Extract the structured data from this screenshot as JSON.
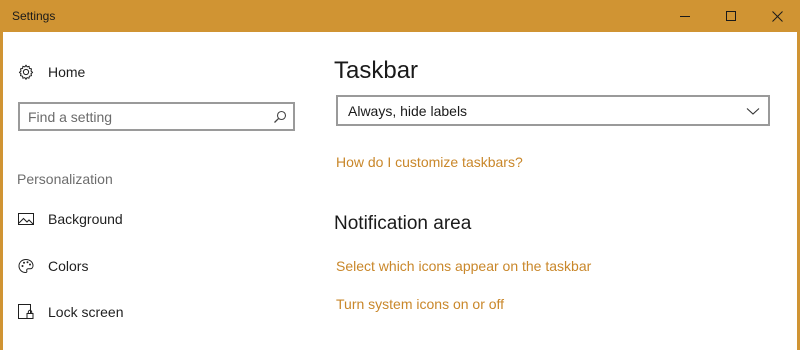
{
  "window": {
    "title": "Settings"
  },
  "sidebar": {
    "home_label": "Home",
    "search_placeholder": "Find a setting",
    "section_label": "Personalization",
    "items": [
      {
        "label": "Background",
        "icon": "picture-icon"
      },
      {
        "label": "Colors",
        "icon": "palette-icon"
      },
      {
        "label": "Lock screen",
        "icon": "lock-screen-icon"
      }
    ]
  },
  "main": {
    "title": "Taskbar",
    "dropdown_value": "Always, hide labels",
    "help_link": "How do I customize taskbars?",
    "notification_heading": "Notification area",
    "notification_links": [
      "Select which icons appear on the taskbar",
      "Turn system icons on or off"
    ]
  },
  "colors": {
    "accent": "#d09433",
    "link": "#c9872a"
  }
}
